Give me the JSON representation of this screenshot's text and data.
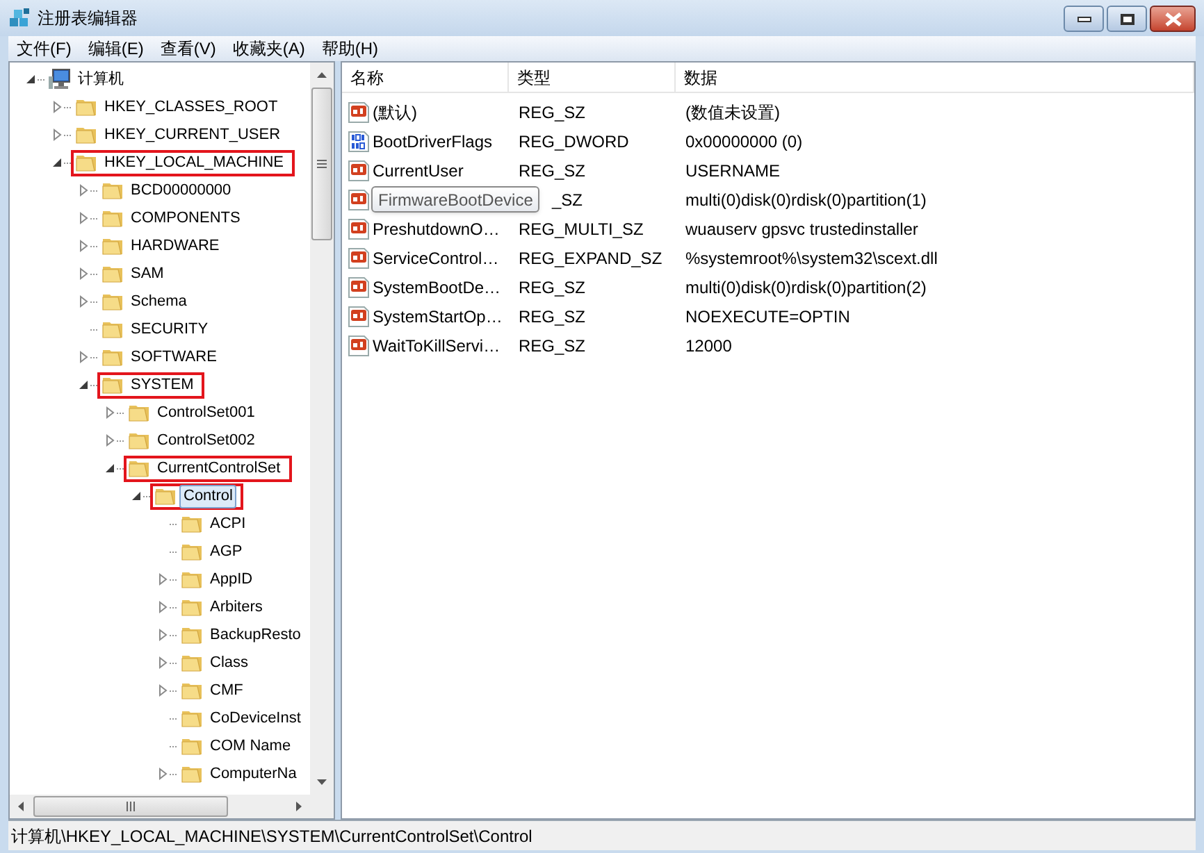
{
  "window": {
    "title": "注册表编辑器"
  },
  "menu": [
    "文件(F)",
    "编辑(E)",
    "查看(V)",
    "收藏夹(A)",
    "帮助(H)"
  ],
  "tree": {
    "label": "计算机",
    "kind": "computer",
    "expandable": true,
    "expanded": true,
    "selected": false,
    "highlighted": false,
    "children": [
      {
        "label": "HKEY_CLASSES_ROOT",
        "expandable": true,
        "expanded": false,
        "selected": false,
        "highlighted": false
      },
      {
        "label": "HKEY_CURRENT_USER",
        "expandable": true,
        "expanded": false,
        "selected": false,
        "highlighted": false
      },
      {
        "label": "HKEY_LOCAL_MACHINE",
        "expandable": true,
        "expanded": true,
        "selected": false,
        "highlighted": true,
        "children": [
          {
            "label": "BCD00000000",
            "expandable": true,
            "expanded": false,
            "selected": false,
            "highlighted": false
          },
          {
            "label": "COMPONENTS",
            "expandable": true,
            "expanded": false,
            "selected": false,
            "highlighted": false
          },
          {
            "label": "HARDWARE",
            "expandable": true,
            "expanded": false,
            "selected": false,
            "highlighted": false
          },
          {
            "label": "SAM",
            "expandable": true,
            "expanded": false,
            "selected": false,
            "highlighted": false
          },
          {
            "label": "Schema",
            "expandable": true,
            "expanded": false,
            "selected": false,
            "highlighted": false
          },
          {
            "label": "SECURITY",
            "expandable": false,
            "selected": false,
            "highlighted": false
          },
          {
            "label": "SOFTWARE",
            "expandable": true,
            "expanded": false,
            "selected": false,
            "highlighted": false
          },
          {
            "label": "SYSTEM",
            "expandable": true,
            "expanded": true,
            "selected": false,
            "highlighted": true,
            "children": [
              {
                "label": "ControlSet001",
                "expandable": true,
                "expanded": false,
                "selected": false,
                "highlighted": false
              },
              {
                "label": "ControlSet002",
                "expandable": true,
                "expanded": false,
                "selected": false,
                "highlighted": false
              },
              {
                "label": "CurrentControlSet",
                "expandable": true,
                "expanded": true,
                "selected": false,
                "highlighted": true,
                "children": [
                  {
                    "label": "Control",
                    "expandable": true,
                    "expanded": true,
                    "selected": true,
                    "highlighted": true,
                    "children": [
                      {
                        "label": "ACPI",
                        "expandable": false,
                        "selected": false,
                        "highlighted": false
                      },
                      {
                        "label": "AGP",
                        "expandable": false,
                        "selected": false,
                        "highlighted": false
                      },
                      {
                        "label": "AppID",
                        "expandable": true,
                        "expanded": false,
                        "selected": false,
                        "highlighted": false
                      },
                      {
                        "label": "Arbiters",
                        "expandable": true,
                        "expanded": false,
                        "selected": false,
                        "highlighted": false
                      },
                      {
                        "label": "BackupResto",
                        "expandable": true,
                        "expanded": false,
                        "selected": false,
                        "highlighted": false
                      },
                      {
                        "label": "Class",
                        "expandable": true,
                        "expanded": false,
                        "selected": false,
                        "highlighted": false
                      },
                      {
                        "label": "CMF",
                        "expandable": true,
                        "expanded": false,
                        "selected": false,
                        "highlighted": false
                      },
                      {
                        "label": "CoDeviceInst",
                        "expandable": false,
                        "selected": false,
                        "highlighted": false
                      },
                      {
                        "label": "COM Name",
                        "expandable": false,
                        "selected": false,
                        "highlighted": false
                      },
                      {
                        "label": "ComputerNa",
                        "expandable": true,
                        "expanded": false,
                        "selected": false,
                        "highlighted": false
                      }
                    ]
                  }
                ]
              }
            ]
          }
        ]
      }
    ]
  },
  "list": {
    "columns": [
      "名称",
      "类型",
      "数据"
    ],
    "rows": [
      {
        "kind": "string",
        "name": "(默认)",
        "type": "REG_SZ",
        "data": "(数值未设置)"
      },
      {
        "kind": "binary",
        "name": "BootDriverFlags",
        "type": "REG_DWORD",
        "data": "0x00000000 (0)"
      },
      {
        "kind": "string",
        "name": "CurrentUser",
        "type": "REG_SZ",
        "data": "USERNAME"
      },
      {
        "kind": "string",
        "tooltip": "FirmwareBootDevice",
        "type": "_SZ",
        "data": "multi(0)disk(0)rdisk(0)partition(1)"
      },
      {
        "kind": "string",
        "name": "PreshutdownO…",
        "type": "REG_MULTI_SZ",
        "data": "wuauserv gpsvc trustedinstaller"
      },
      {
        "kind": "string",
        "name": "ServiceControl…",
        "type": "REG_EXPAND_SZ",
        "data": "%systemroot%\\system32\\scext.dll"
      },
      {
        "kind": "string",
        "name": "SystemBootDe…",
        "type": "REG_SZ",
        "data": "multi(0)disk(0)rdisk(0)partition(2)"
      },
      {
        "kind": "string",
        "name": "SystemStartOp…",
        "type": "REG_SZ",
        "data": "NOEXECUTE=OPTIN"
      },
      {
        "kind": "string",
        "name": "WaitToKillServi…",
        "type": "REG_SZ",
        "data": "12000"
      }
    ]
  },
  "status_bar": "计算机\\HKEY_LOCAL_MACHINE\\SYSTEM\\CurrentControlSet\\Control"
}
